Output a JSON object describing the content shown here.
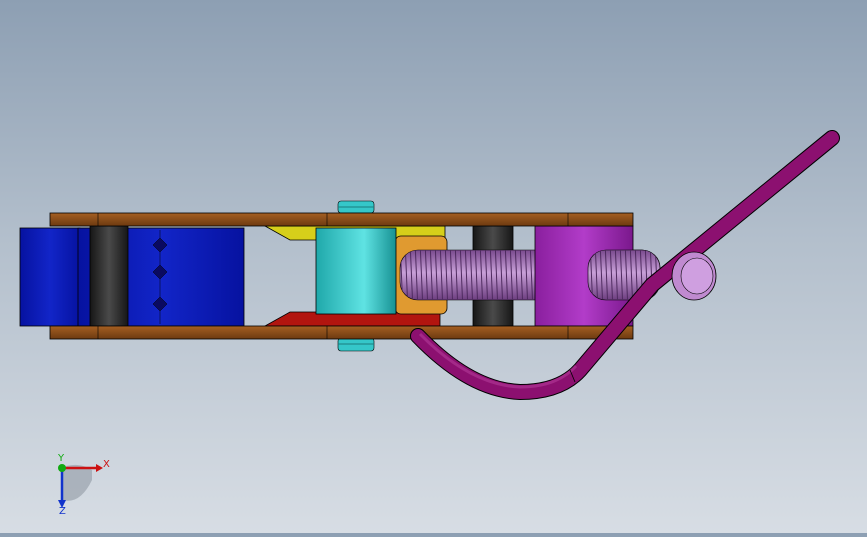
{
  "viewport": {
    "background_top": "#8d9fb3",
    "background_bottom": "#d7dde4"
  },
  "colors": {
    "frame_plate": "#8b4a14",
    "end_block": "#0a13a8",
    "dark_roller": "#2b2b2b",
    "pin": "#35c7c9",
    "yellow_link": "#d8d21c",
    "red_link": "#b0140e",
    "orange_nut": "#e09a30",
    "screw": "#9a68b0",
    "handle": "#8c1070",
    "handle_end": "#c08ad0"
  },
  "triad": {
    "x_label": "X",
    "y_label": "Y",
    "z_label": "Z",
    "x_color": "#cc1111",
    "y_color": "#11aa11",
    "z_color": "#1133cc"
  }
}
